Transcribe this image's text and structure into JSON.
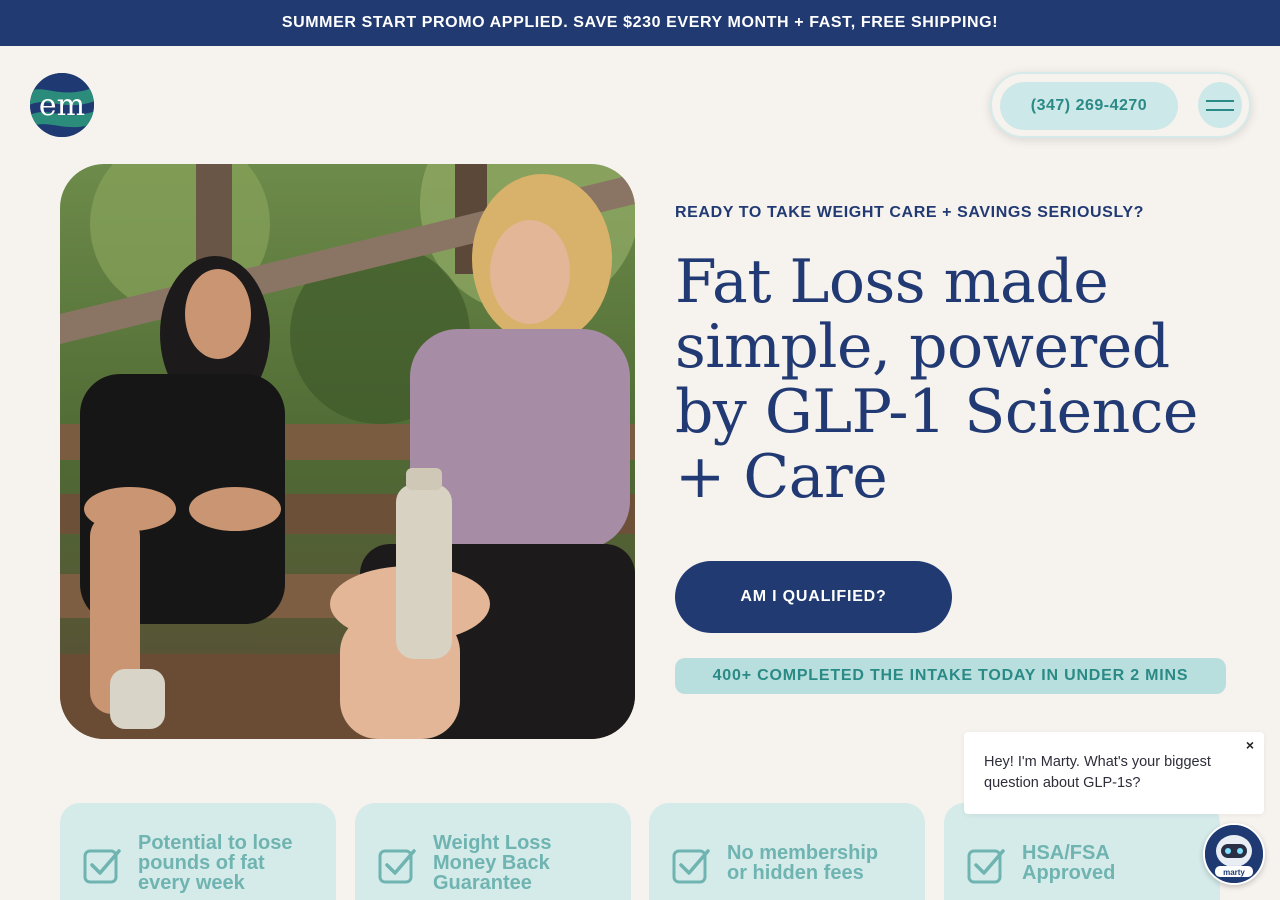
{
  "promo": {
    "text": "SUMMER START PROMO APPLIED. SAVE $230 EVERY MONTH + FAST, FREE SHIPPING!"
  },
  "header": {
    "logo_text": "em",
    "phone": "(347) 269-4270",
    "menu_icon": "hamburger-icon"
  },
  "hero": {
    "image": "two-women-sitting-on-outdoor-steps-photo",
    "eyebrow": "READY TO TAKE WEIGHT CARE + SAVINGS SERIOUSLY?",
    "headline": "Fat Loss made simple, powered by GLP-1 Science + Care",
    "cta_label": "AM I QUALIFIED?",
    "social_proof": "400+ COMPLETED THE INTAKE TODAY IN UNDER 2 MINS"
  },
  "features": [
    {
      "text": "Potential to lose\npounds of fat\nevery week",
      "icon": "checkbox-icon"
    },
    {
      "text": "Weight Loss\nMoney Back\nGuarantee",
      "icon": "checkbox-icon"
    },
    {
      "text": "No membership\nor hidden fees",
      "icon": "checkbox-icon"
    },
    {
      "text": "HSA/FSA\nApproved",
      "icon": "checkbox-icon"
    }
  ],
  "chat": {
    "message": "Hey! I'm Marty. What's your biggest question about GLP-1s?",
    "close": "×",
    "avatar_label": "marty"
  },
  "colors": {
    "navy": "#213a72",
    "teal_text": "#2a8a86",
    "teal_light": "#cde8e8",
    "card_bg": "#d4ebea",
    "page_bg": "#f6f2ee"
  }
}
